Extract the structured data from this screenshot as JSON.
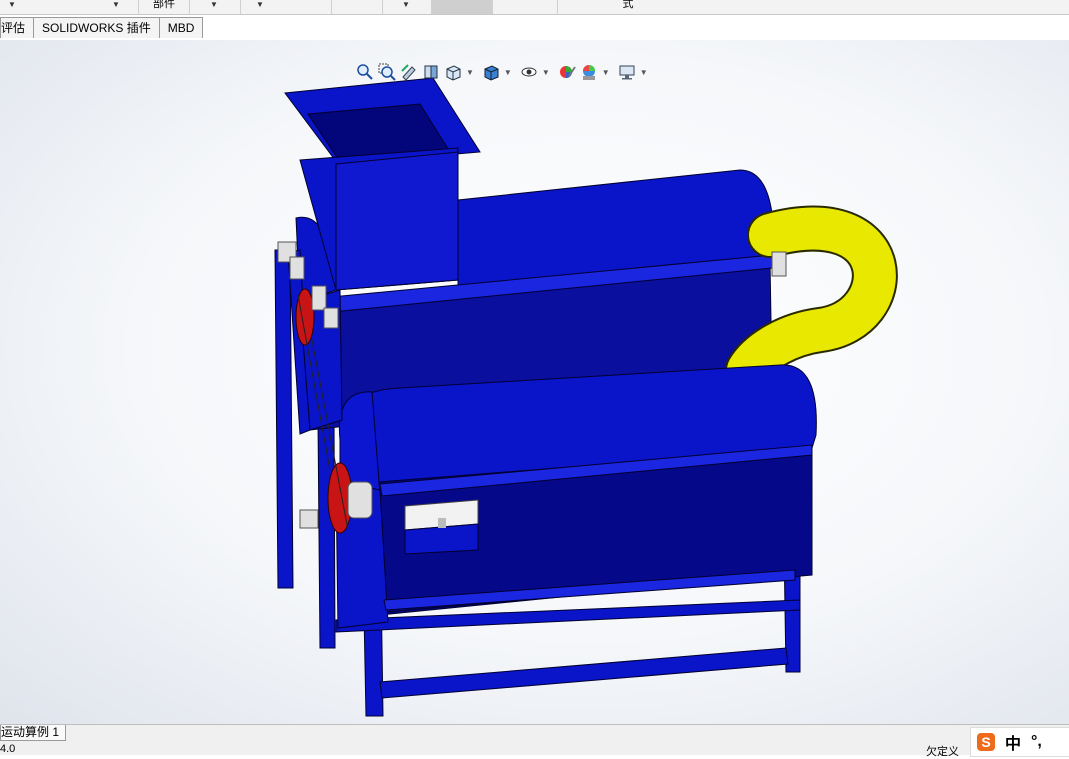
{
  "topbar": {
    "cell_partial_1": "部件",
    "cell_partial_2": "式"
  },
  "tabs": [
    "评估",
    "SOLIDWORKS 插件",
    "MBD"
  ],
  "hud_icons": [
    "zoom-to-fit-icon",
    "zoom-area-icon",
    "previous-view-icon",
    "section-view-icon",
    "view-orientation-icon",
    "display-style-icon",
    "hide-show-icon",
    "edit-appearance-icon",
    "apply-scene-icon",
    "view-settings-icon"
  ],
  "status": {
    "motion_tab": "运动算例 1",
    "left_text": "4.0",
    "right_text": "欠定义"
  },
  "ime": {
    "logo": "S",
    "lang": "中",
    "punct": "°,"
  },
  "colors": {
    "machine_body": "#0a14c8",
    "pipe": "#e8e800",
    "pulley": "#c81414",
    "ime_logo": "#ef6b1c"
  }
}
